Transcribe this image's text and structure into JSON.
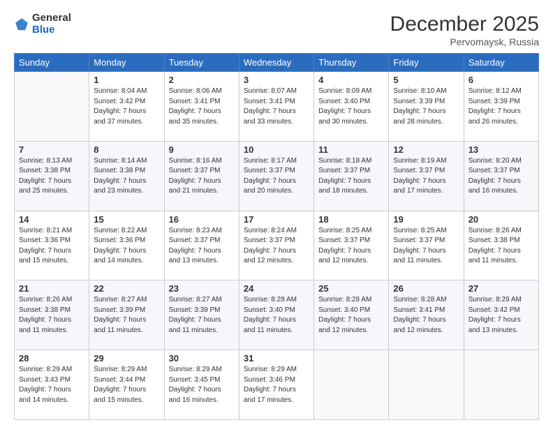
{
  "header": {
    "logo_general": "General",
    "logo_blue": "Blue",
    "month_title": "December 2025",
    "location": "Pervomaysk, Russia"
  },
  "days_of_week": [
    "Sunday",
    "Monday",
    "Tuesday",
    "Wednesday",
    "Thursday",
    "Friday",
    "Saturday"
  ],
  "weeks": [
    [
      {
        "day": "",
        "info": ""
      },
      {
        "day": "1",
        "info": "Sunrise: 8:04 AM\nSunset: 3:42 PM\nDaylight: 7 hours\nand 37 minutes."
      },
      {
        "day": "2",
        "info": "Sunrise: 8:06 AM\nSunset: 3:41 PM\nDaylight: 7 hours\nand 35 minutes."
      },
      {
        "day": "3",
        "info": "Sunrise: 8:07 AM\nSunset: 3:41 PM\nDaylight: 7 hours\nand 33 minutes."
      },
      {
        "day": "4",
        "info": "Sunrise: 8:09 AM\nSunset: 3:40 PM\nDaylight: 7 hours\nand 30 minutes."
      },
      {
        "day": "5",
        "info": "Sunrise: 8:10 AM\nSunset: 3:39 PM\nDaylight: 7 hours\nand 28 minutes."
      },
      {
        "day": "6",
        "info": "Sunrise: 8:12 AM\nSunset: 3:39 PM\nDaylight: 7 hours\nand 26 minutes."
      }
    ],
    [
      {
        "day": "7",
        "info": "Sunrise: 8:13 AM\nSunset: 3:38 PM\nDaylight: 7 hours\nand 25 minutes."
      },
      {
        "day": "8",
        "info": "Sunrise: 8:14 AM\nSunset: 3:38 PM\nDaylight: 7 hours\nand 23 minutes."
      },
      {
        "day": "9",
        "info": "Sunrise: 8:16 AM\nSunset: 3:37 PM\nDaylight: 7 hours\nand 21 minutes."
      },
      {
        "day": "10",
        "info": "Sunrise: 8:17 AM\nSunset: 3:37 PM\nDaylight: 7 hours\nand 20 minutes."
      },
      {
        "day": "11",
        "info": "Sunrise: 8:18 AM\nSunset: 3:37 PM\nDaylight: 7 hours\nand 18 minutes."
      },
      {
        "day": "12",
        "info": "Sunrise: 8:19 AM\nSunset: 3:37 PM\nDaylight: 7 hours\nand 17 minutes."
      },
      {
        "day": "13",
        "info": "Sunrise: 8:20 AM\nSunset: 3:37 PM\nDaylight: 7 hours\nand 16 minutes."
      }
    ],
    [
      {
        "day": "14",
        "info": "Sunrise: 8:21 AM\nSunset: 3:36 PM\nDaylight: 7 hours\nand 15 minutes."
      },
      {
        "day": "15",
        "info": "Sunrise: 8:22 AM\nSunset: 3:36 PM\nDaylight: 7 hours\nand 14 minutes."
      },
      {
        "day": "16",
        "info": "Sunrise: 8:23 AM\nSunset: 3:37 PM\nDaylight: 7 hours\nand 13 minutes."
      },
      {
        "day": "17",
        "info": "Sunrise: 8:24 AM\nSunset: 3:37 PM\nDaylight: 7 hours\nand 12 minutes."
      },
      {
        "day": "18",
        "info": "Sunrise: 8:25 AM\nSunset: 3:37 PM\nDaylight: 7 hours\nand 12 minutes."
      },
      {
        "day": "19",
        "info": "Sunrise: 8:25 AM\nSunset: 3:37 PM\nDaylight: 7 hours\nand 11 minutes."
      },
      {
        "day": "20",
        "info": "Sunrise: 8:26 AM\nSunset: 3:38 PM\nDaylight: 7 hours\nand 11 minutes."
      }
    ],
    [
      {
        "day": "21",
        "info": "Sunrise: 8:26 AM\nSunset: 3:38 PM\nDaylight: 7 hours\nand 11 minutes."
      },
      {
        "day": "22",
        "info": "Sunrise: 8:27 AM\nSunset: 3:39 PM\nDaylight: 7 hours\nand 11 minutes."
      },
      {
        "day": "23",
        "info": "Sunrise: 8:27 AM\nSunset: 3:39 PM\nDaylight: 7 hours\nand 11 minutes."
      },
      {
        "day": "24",
        "info": "Sunrise: 8:28 AM\nSunset: 3:40 PM\nDaylight: 7 hours\nand 11 minutes."
      },
      {
        "day": "25",
        "info": "Sunrise: 8:28 AM\nSunset: 3:40 PM\nDaylight: 7 hours\nand 12 minutes."
      },
      {
        "day": "26",
        "info": "Sunrise: 8:28 AM\nSunset: 3:41 PM\nDaylight: 7 hours\nand 12 minutes."
      },
      {
        "day": "27",
        "info": "Sunrise: 8:29 AM\nSunset: 3:42 PM\nDaylight: 7 hours\nand 13 minutes."
      }
    ],
    [
      {
        "day": "28",
        "info": "Sunrise: 8:29 AM\nSunset: 3:43 PM\nDaylight: 7 hours\nand 14 minutes."
      },
      {
        "day": "29",
        "info": "Sunrise: 8:29 AM\nSunset: 3:44 PM\nDaylight: 7 hours\nand 15 minutes."
      },
      {
        "day": "30",
        "info": "Sunrise: 8:29 AM\nSunset: 3:45 PM\nDaylight: 7 hours\nand 16 minutes."
      },
      {
        "day": "31",
        "info": "Sunrise: 8:29 AM\nSunset: 3:46 PM\nDaylight: 7 hours\nand 17 minutes."
      },
      {
        "day": "",
        "info": ""
      },
      {
        "day": "",
        "info": ""
      },
      {
        "day": "",
        "info": ""
      }
    ]
  ]
}
